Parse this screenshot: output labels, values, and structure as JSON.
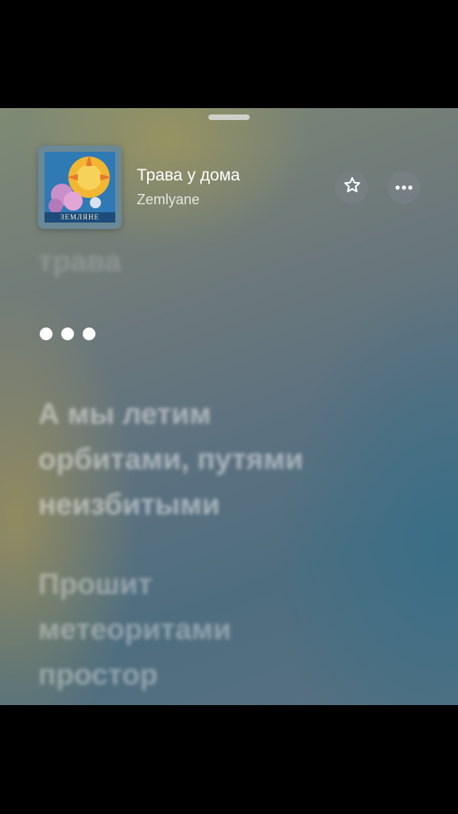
{
  "track": {
    "title": "Трава у дома",
    "artist": "Zemlyane",
    "artwork_caption": "ЗЕМЛЯНЕ"
  },
  "icons": {
    "favorite": "star-outline-icon",
    "more": "ellipsis-icon",
    "interlude": "three-dots-indicator"
  },
  "lyrics": {
    "previous_line": "трава",
    "line_1": [
      "А мы летим",
      "орбитами, путями",
      "неизбитыми"
    ],
    "line_2": [
      "Прошит",
      "метеоритами",
      "простор"
    ]
  },
  "colors": {
    "text_primary": "#ffffff",
    "button_bg": "#7a8287"
  }
}
